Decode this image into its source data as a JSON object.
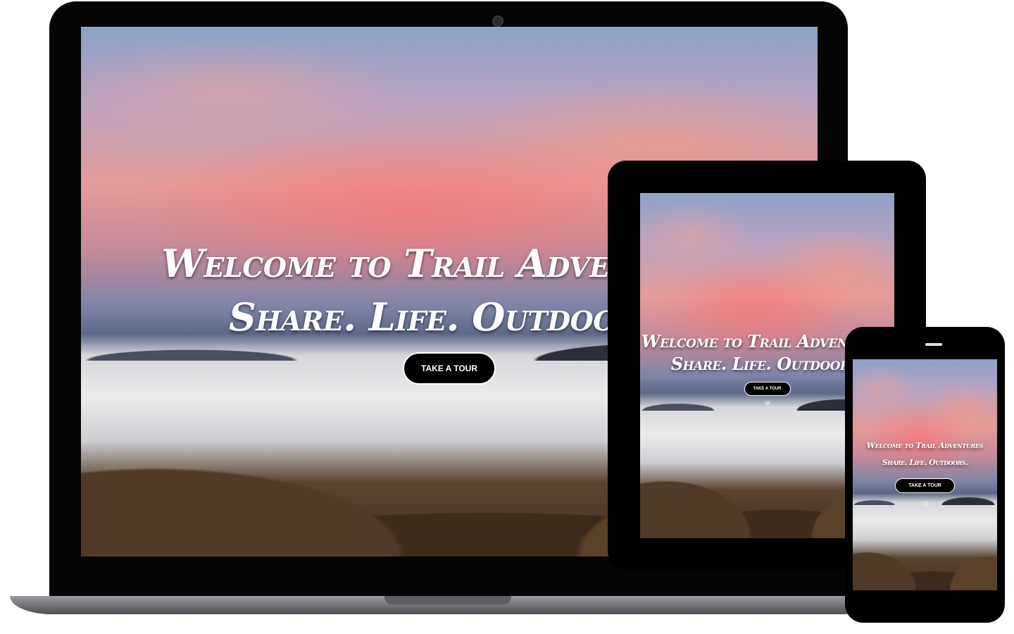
{
  "hero": {
    "title": "Welcome to Trail Adventures",
    "tagline": "Share. Life. Outdoors.",
    "cta_label": "TAKE A TOUR",
    "scroll_icon": "double-chevron-down-icon"
  },
  "colors": {
    "button_bg": "#000000",
    "button_text": "#ffffff",
    "hero_text": "#ffffff"
  }
}
